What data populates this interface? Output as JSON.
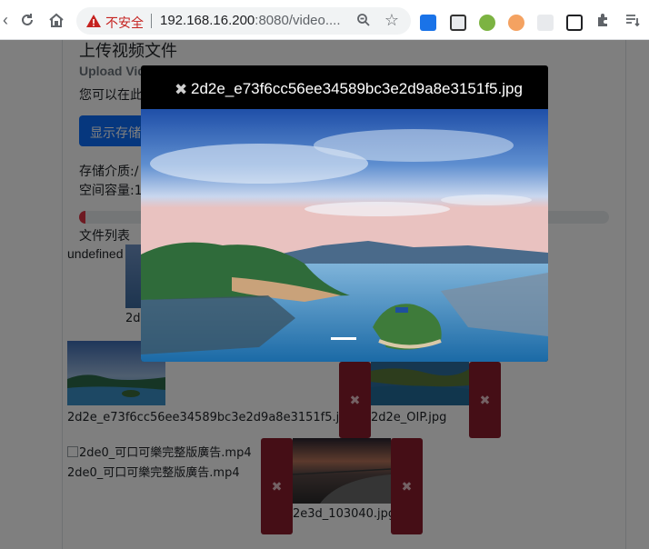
{
  "browser": {
    "security_label": "不安全",
    "url_host": "192.168.16.200",
    "url_rest": ":8080/video....",
    "icons": [
      "back-icon",
      "reload-icon",
      "home-icon",
      "warning-icon",
      "zoom-icon",
      "star-icon",
      "extensions-icon",
      "reading-list-icon"
    ]
  },
  "page": {
    "title": "上传视频文件",
    "subtitle": "Upload Vid",
    "description": "您可以在此",
    "show_storage_button": "显示存储",
    "storage_media": "存储介质:/",
    "space_capacity": "空间容量:1",
    "usage_fraction": 0.012,
    "file_list_label": "文件列表",
    "undefined_text": "undefined",
    "partial_caption": "2d",
    "files": [
      {
        "name": "2d2e_e73f6cc56ee34589bc3e2d9a8e3151f5.jpg",
        "delete_icon": "close-icon"
      },
      {
        "name": "2d2e_OIP.jpg",
        "delete_icon": "close-icon"
      },
      {
        "name": "2de0_可口可樂完整版廣告.mp4",
        "alt_text": "2de0_可口可樂完整版廣告.mp4",
        "delete_icon": "close-icon"
      },
      {
        "name": "2e3d_103040.jpg",
        "delete_icon": "close-icon"
      }
    ]
  },
  "modal": {
    "title": "2d2e_e73f6cc56ee34589bc3e2d9a8e3151f5.jpg",
    "close_icon": "close-icon"
  },
  "colors": {
    "primary": "#0d6efd",
    "danger": "#dc3545",
    "delete_button": "#8b1d2c",
    "insecure": "#c5221f"
  }
}
